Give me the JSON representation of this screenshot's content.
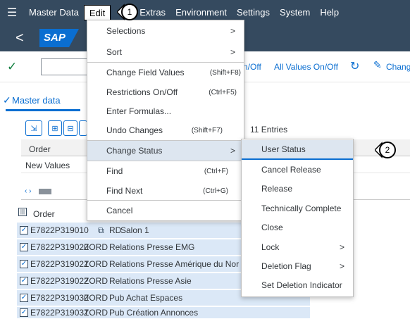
{
  "menubar": {
    "items": [
      "Master Data",
      "Edit",
      "Extras",
      "Environment",
      "Settings",
      "System",
      "Help"
    ]
  },
  "titlebar": {
    "logo": "SAP"
  },
  "toolbar": {
    "on_off_label": "n/Off",
    "all_values_label": "All Values On/Off",
    "change_label": "Chang"
  },
  "tab": {
    "label": "Master data"
  },
  "grid": {
    "entries_label": "11 Entries",
    "header_order": "Order",
    "new_values_label": "New Values"
  },
  "table": {
    "header_order": "Order",
    "rows": [
      {
        "order": "E7822P319010",
        "type": "RD",
        "desc": "Salon 1"
      },
      {
        "order": "E7822P319020",
        "type": "ZORD",
        "desc": "Relations Presse EMG"
      },
      {
        "order": "E7822P319021",
        "type": "ZORD",
        "desc": "Relations Presse Amérique du Nor"
      },
      {
        "order": "E7822P319022",
        "type": "ZORD",
        "desc": "Relations Presse Asie"
      },
      {
        "order": "E7822P319030",
        "type": "ZORD",
        "desc": "Pub Achat Espaces"
      },
      {
        "order": "E7822P319031",
        "type": "ZORD",
        "desc": "Pub Création Annonces"
      }
    ]
  },
  "edit_menu": {
    "items": [
      {
        "label": "Selections",
        "shortcut": "",
        "submenu": true
      },
      {
        "label": "Sort",
        "shortcut": "",
        "submenu": true
      },
      {
        "label": "Change Field Values",
        "shortcut": "(Shift+F8)",
        "submenu": false
      },
      {
        "label": "Restrictions On/Off",
        "shortcut": "(Ctrl+F5)",
        "submenu": false
      },
      {
        "label": "Enter Formulas...",
        "shortcut": "",
        "submenu": false
      },
      {
        "label": "Undo Changes",
        "shortcut": "(Shift+F7)",
        "submenu": false
      },
      {
        "label": "Change Status",
        "shortcut": "",
        "submenu": true
      },
      {
        "label": "Find",
        "shortcut": "(Ctrl+F)",
        "submenu": false
      },
      {
        "label": "Find Next",
        "shortcut": "(Ctrl+G)",
        "submenu": false
      },
      {
        "label": "Cancel",
        "shortcut": "",
        "submenu": false
      }
    ]
  },
  "status_menu": {
    "items": [
      {
        "label": "User Status",
        "submenu": false
      },
      {
        "label": "Cancel Release",
        "submenu": false
      },
      {
        "label": "Release",
        "submenu": false
      },
      {
        "label": "Technically Complete",
        "submenu": false
      },
      {
        "label": "Close",
        "submenu": false
      },
      {
        "label": "Lock",
        "submenu": true
      },
      {
        "label": "Deletion Flag",
        "submenu": true
      },
      {
        "label": "Set Deletion Indicator",
        "submenu": false
      }
    ]
  },
  "callouts": [
    "1",
    "2"
  ],
  "colors": {
    "shell": "#354a5f",
    "accent": "#0a6ed1",
    "selection": "#dbe8f7",
    "success": "#107e3e"
  },
  "glyphs": {
    "arrow": ">",
    "check": "✓",
    "back": "<"
  }
}
